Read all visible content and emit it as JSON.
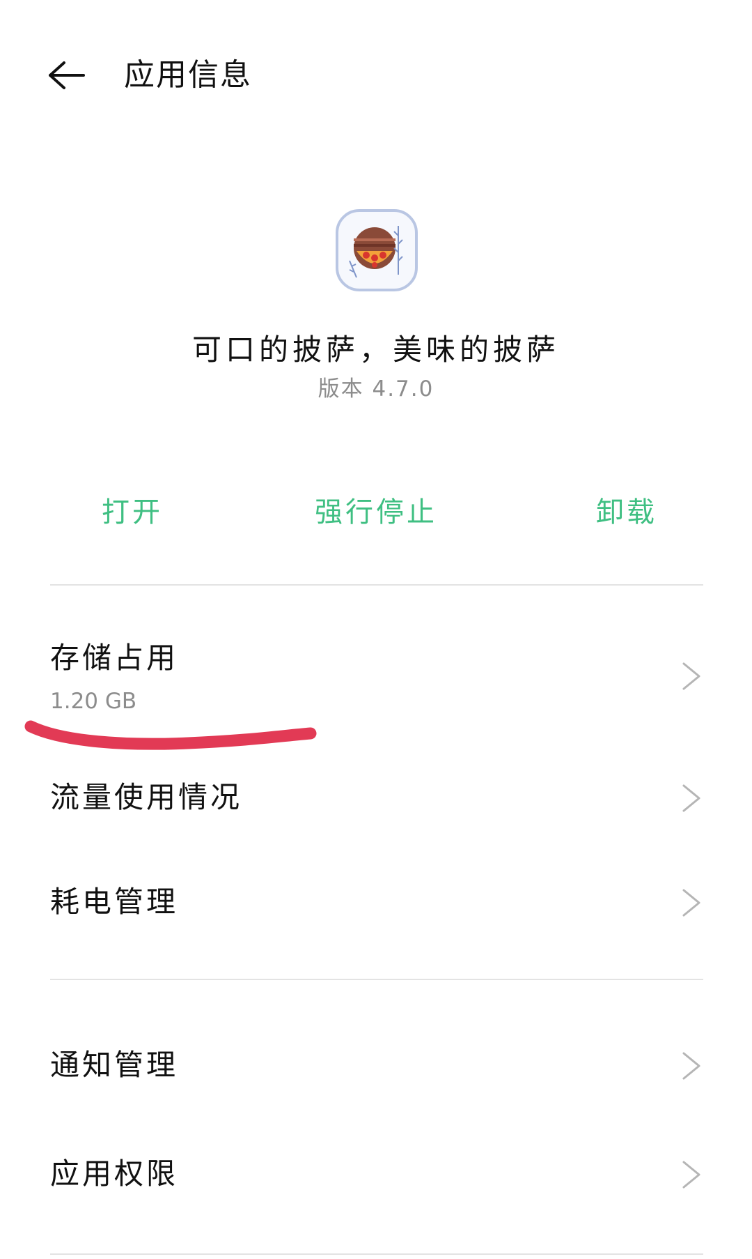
{
  "header": {
    "title": "应用信息"
  },
  "app": {
    "name": "可口的披萨，美味的披萨",
    "version": "版本 4.7.0",
    "icon": "pizza-icon"
  },
  "actions": {
    "open": "打开",
    "force_stop": "强行停止",
    "uninstall": "卸载",
    "color": "#3fbf82"
  },
  "settings": {
    "storage": {
      "label": "存储占用",
      "value": "1.20 GB"
    },
    "data_usage": {
      "label": "流量使用情况"
    },
    "battery": {
      "label": "耗电管理"
    },
    "notifications": {
      "label": "通知管理"
    },
    "permissions": {
      "label": "应用权限"
    }
  },
  "annotation_color": "#e23a55"
}
